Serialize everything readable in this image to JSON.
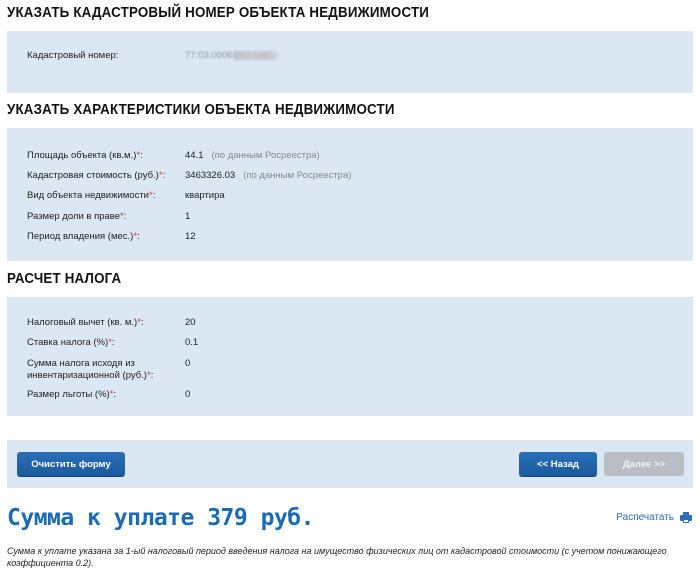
{
  "sections": {
    "cadastral": {
      "title": "УКАЗАТЬ КАДАСТРОВЫЙ НОМЕР ОБЪЕКТА НЕДВИЖИМОСТИ",
      "number_label": "Кадастровый номер:",
      "number_value_visible": "77:03:0006"
    },
    "characteristics": {
      "title": "УКАЗАТЬ ХАРАКТЕРИСТИКИ ОБЪЕКТА НЕДВИЖИМОСТИ",
      "rows": [
        {
          "label": "Площадь объекта (кв.м.)",
          "value": "44.1",
          "note": "(по данным Росреестра)"
        },
        {
          "label": "Кадастровая стоимость (руб.)",
          "value": "3463326.03",
          "note": "(по данным Росреестра)"
        },
        {
          "label": "Вид объекта недвижимости",
          "value": "квартира",
          "note": ""
        },
        {
          "label": "Размер доли в праве",
          "value": "1",
          "note": ""
        },
        {
          "label": "Период владения (мес.)",
          "value": "12",
          "note": ""
        }
      ]
    },
    "tax": {
      "title": "РАСЧЕТ НАЛОГА",
      "rows": [
        {
          "label": "Налоговый вычет (кв. м.)",
          "value": "20"
        },
        {
          "label": "Ставка налога (%)",
          "value": "0.1"
        },
        {
          "label": "Сумма налога исходя из инвентаризационной (руб.)",
          "value": "0"
        },
        {
          "label": "Размер льготы (%)",
          "value": "0"
        }
      ]
    }
  },
  "required_mark": "*",
  "label_suffix": ":",
  "buttons": {
    "clear": "Очистить форму",
    "back": "<< Назад",
    "next": "Далее >>"
  },
  "result": {
    "total": "Сумма к уплате 379 руб.",
    "print_label": "Распечатать",
    "footnote": "Сумма к уплате указана за 1-ый налоговый период введения налога на имущество физических лиц от кадастровой стоимости (с учетом понижающего коэффициента 0.2)."
  },
  "colors": {
    "panel_bg": "#dbe7f3",
    "accent": "#1a6bb3",
    "required": "#d23a2a",
    "button_disabled": "#b9bec4"
  },
  "icons": {
    "print": "printer-icon"
  }
}
